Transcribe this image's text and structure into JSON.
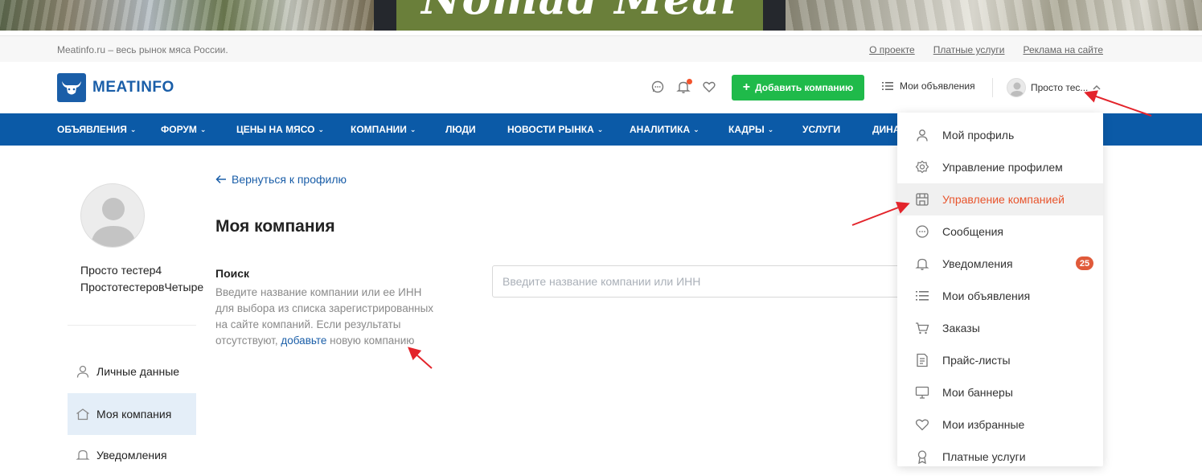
{
  "banner": {
    "text": "Nomad Meal"
  },
  "topbar": {
    "tagline": "Meatinfo.ru – весь рынок мяса России.",
    "links": [
      "О проекте",
      "Платные услуги",
      "Реклама на сайте"
    ]
  },
  "header": {
    "logo_text": "MEATINFO",
    "add_company_label": "Добавить компанию",
    "my_ads_label": "Мои объявления",
    "user_name": "Просто тес..."
  },
  "nav": {
    "items": [
      {
        "label": "ОБЪЯВЛЕНИЯ"
      },
      {
        "label": "ФОРУМ"
      },
      {
        "label": "ЦЕНЫ НА МЯСО"
      },
      {
        "label": "КОМПАНИИ"
      },
      {
        "label": "ЛЮДИ"
      },
      {
        "label": "НОВОСТИ РЫНКА"
      },
      {
        "label": "АНАЛИТИКА"
      },
      {
        "label": "КАДРЫ"
      },
      {
        "label": "УСЛУГИ"
      },
      {
        "label": "ДИНА"
      }
    ]
  },
  "sidebar": {
    "profile_name": "Просто тестер4 ПростотестеровЧетыре",
    "items": [
      {
        "label": "Личные данные"
      },
      {
        "label": "Моя компания"
      },
      {
        "label": "Уведомления"
      }
    ]
  },
  "main": {
    "back_label": "Вернуться к профилю",
    "title": "Моя компания",
    "search_label": "Поиск",
    "search_help": "Введите название компании или ее ИНН для выбора из списка зарегистрированных на сайте компаний. Если результаты отсутствуют,",
    "search_help_link": "добавьте",
    "search_help_tail": "новую компанию",
    "search_placeholder": "Введите название компании или ИНН",
    "search_value": ""
  },
  "dropdown": {
    "items": [
      {
        "label": "Мой профиль",
        "icon": "user-icon"
      },
      {
        "label": "Управление профилем",
        "icon": "settings-icon"
      },
      {
        "label": "Управление компанией",
        "icon": "store-icon"
      },
      {
        "label": "Сообщения",
        "icon": "chat-icon"
      },
      {
        "label": "Уведомления",
        "icon": "bell-icon",
        "badge": "25"
      },
      {
        "label": "Мои объявления",
        "icon": "list-icon"
      },
      {
        "label": "Заказы",
        "icon": "cart-icon"
      },
      {
        "label": "Прайс-листы",
        "icon": "document-icon"
      },
      {
        "label": "Мои баннеры",
        "icon": "monitor-icon"
      },
      {
        "label": "Мои избранные",
        "icon": "heart-icon"
      },
      {
        "label": "Платные услуги",
        "icon": "award-icon"
      }
    ]
  },
  "colors": {
    "brand_blue": "#0b5aa7",
    "green_button": "#1fba4a",
    "accent_orange": "#e8542c",
    "annotation_red": "#e3242b"
  }
}
